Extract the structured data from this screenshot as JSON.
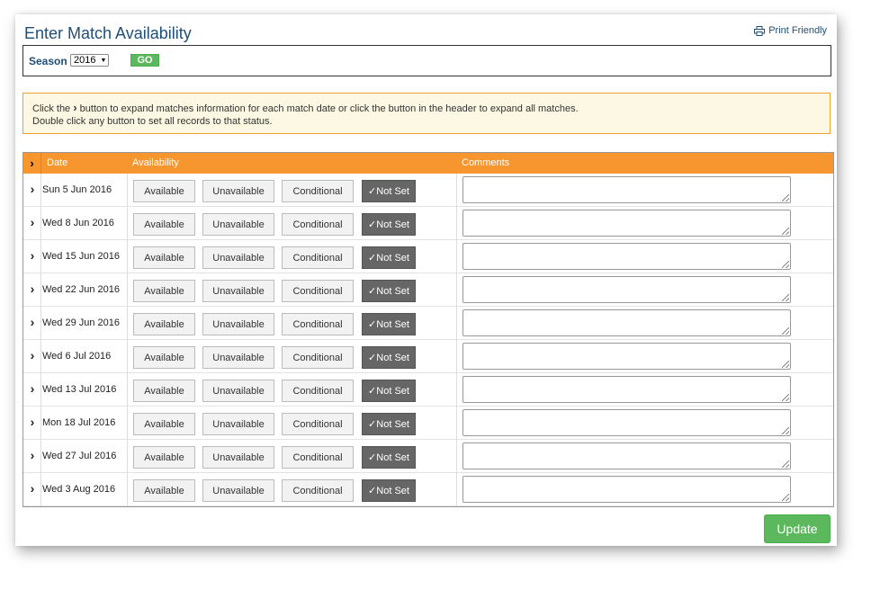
{
  "page": {
    "title": "Enter Match Availability",
    "print_label": "Print Friendly",
    "print_icon": "printer-icon"
  },
  "season": {
    "label": "Season",
    "selected": "2016",
    "go_label": "GO"
  },
  "info": {
    "line1_before": "Click the",
    "line1_after": "button to expand matches information for each match date or click the button in the header to expand all matches.",
    "line2": "Double click any button to set all records to that status."
  },
  "table": {
    "headers": {
      "expand": "›",
      "date": "Date",
      "availability": "Availability",
      "comments": "Comments"
    },
    "buttons": {
      "available": "Available",
      "unavailable": "Unavailable",
      "conditional": "Conditional",
      "not_set": "✓Not Set"
    },
    "rows": [
      {
        "date": "Sun 5 Jun 2016"
      },
      {
        "date": "Wed 8 Jun 2016"
      },
      {
        "date": "Wed 15 Jun 2016"
      },
      {
        "date": "Wed 22 Jun 2016"
      },
      {
        "date": "Wed 29 Jun 2016"
      },
      {
        "date": "Wed 6 Jul 2016"
      },
      {
        "date": "Wed 13 Jul 2016"
      },
      {
        "date": "Mon 18 Jul 2016"
      },
      {
        "date": "Wed 27 Jul 2016"
      },
      {
        "date": "Wed 3 Aug 2016"
      }
    ]
  },
  "update_label": "Update",
  "colors": {
    "accent_header": "#f7962f",
    "title_blue": "#1f4e79",
    "go_green": "#5cb85c",
    "not_set_grey": "#666666",
    "info_bg": "#fcf8e3"
  }
}
